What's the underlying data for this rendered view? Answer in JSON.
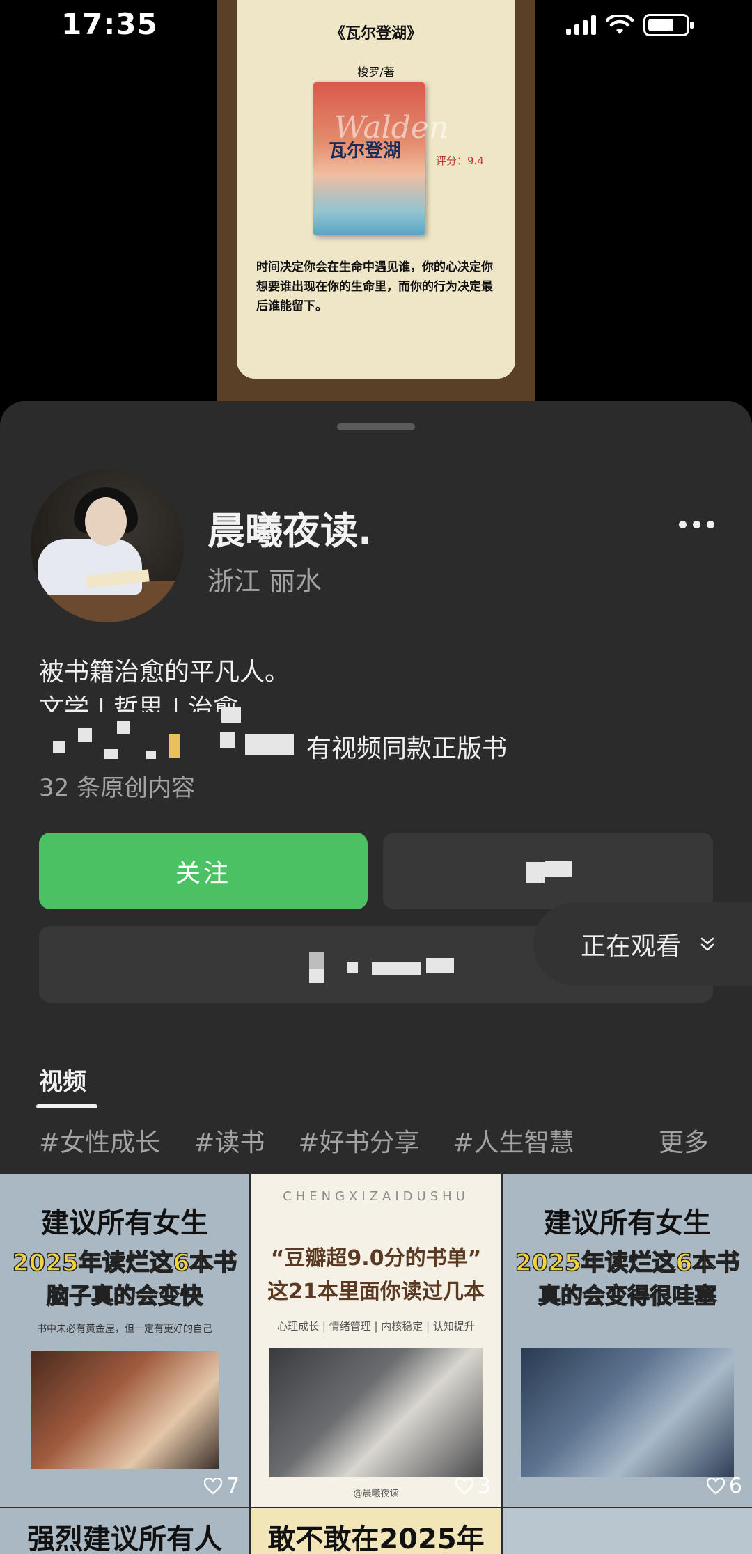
{
  "status_bar": {
    "time": "17:35"
  },
  "video_preview": {
    "book_title": "《瓦尔登湖》",
    "author": "梭罗/著",
    "cover_title": "瓦尔登湖",
    "cover_english": "Walden",
    "rating": "评分：9.4",
    "quote": "时间决定你会在生命中遇见谁，你的心决定你想要谁出现在你的生命里，而你的行为决定最后谁能留下。"
  },
  "profile": {
    "name": "晨曦夜读.",
    "location": "浙江 丽水",
    "bio_line1": "被书籍治愈的平凡人。",
    "bio_line2": "文学 | 哲思 | 治愈",
    "shop_text": "有视频同款正版书",
    "original_count": "32 条原创内容",
    "follow_label": "关注"
  },
  "tabs": {
    "active": "视频"
  },
  "tags": [
    "#女性成长",
    "#读书",
    "#好书分享",
    "#人生智慧"
  ],
  "tags_more": "更多",
  "grid": [
    {
      "line1": "建议所有女生",
      "line2": "2025年读烂这6本书",
      "line3": "脑子真的会变快",
      "sub": "书中未必有黄金屋，但一定有更好的自己",
      "likes": "7"
    },
    {
      "eng": "CHENGXIZAIDUSHU",
      "line1": "“豆瓣超9.0分的书单”",
      "line2": "这21本里面你读过几本",
      "cats": "心理成长 | 情绪管理 | 内核稳定 | 认知提升",
      "handle": "@晨曦夜读",
      "likes": "3"
    },
    {
      "line1": "建议所有女生",
      "line2": "2025年读烂这6本书",
      "line3": "真的会变得很哇塞",
      "likes": "6"
    }
  ],
  "grid_row2": [
    "强烈建议所有人",
    "敢不敢在2025年",
    ""
  ],
  "watching": {
    "label": "正在观看"
  },
  "colors": {
    "follow": "#4cc163",
    "sheet": "#2b2b2b",
    "tag": "#a3a3a3"
  },
  "icons": [
    "signal-icon",
    "wifi-icon",
    "battery-icon",
    "more-icon",
    "heart-icon",
    "chevron-down-icon"
  ]
}
